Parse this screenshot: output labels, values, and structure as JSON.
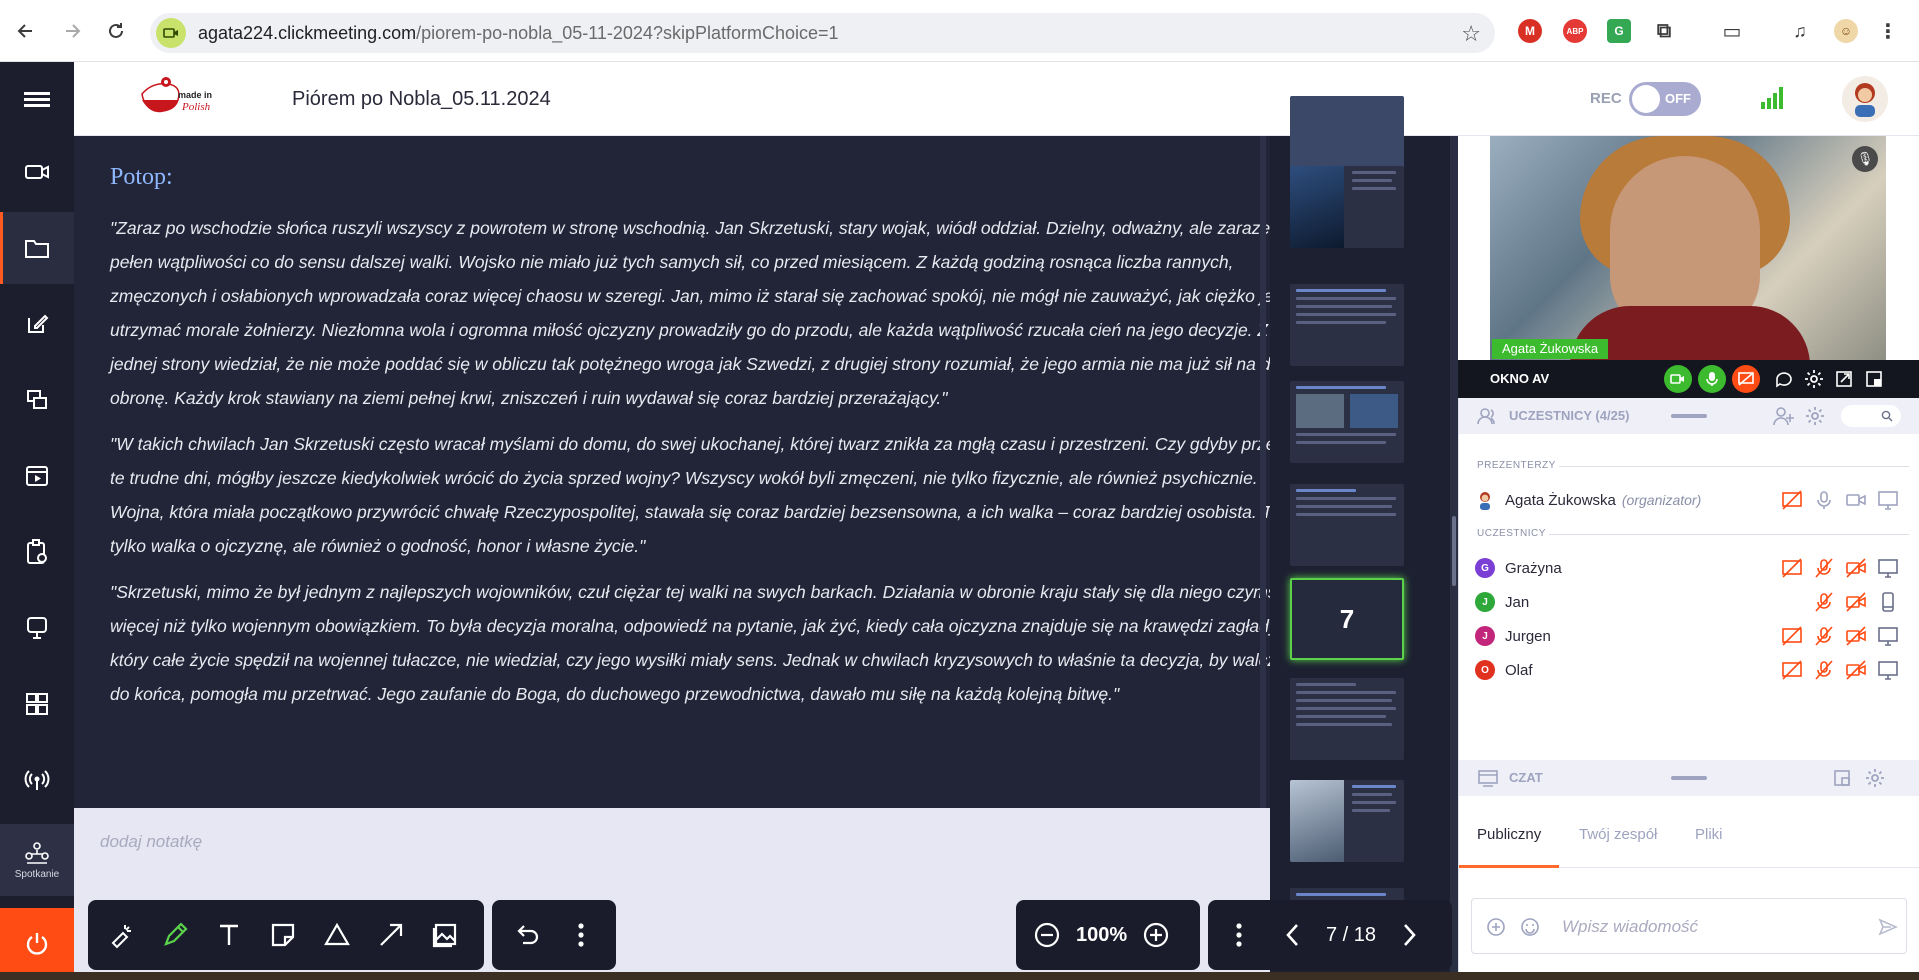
{
  "browser": {
    "url_domain": "agata224.clickmeeting.com",
    "url_path": "/piorem-po-nobla_05-11-2024?skipPlatformChoice=1"
  },
  "header": {
    "meeting_title": "Piórem po Nobla_05.11.2024",
    "rec_label": "REC",
    "rec_state": "OFF"
  },
  "sidebar": {
    "spotkanie_label": "Spotkanie"
  },
  "slide": {
    "title": "Potop:",
    "paragraphs": [
      "\"Zaraz po wschodzie słońca ruszyli wszyscy z powrotem w stronę wschodnią. Jan Skrzetuski, stary wojak, wiódł oddział. Dzielny, odważny, ale zarazem pełen wątpliwości co do sensu dalszej walki. Wojsko nie miało już tych samych sił, co przed miesiącem. Z każdą godziną rosnąca liczba rannych, zmęczonych i osłabionych wprowadzała coraz więcej chaosu w szeregi. Jan, mimo iż starał się zachować spokój, nie mógł nie zauważyć, jak ciężko jest utrzymać morale żołnierzy. Niezłomna wola i ogromna miłość ojczyzny prowadziły go do przodu, ale każda wątpliwość rzucała cień na jego decyzje. Z jednej strony wiedział, że nie może poddać się w obliczu tak potężnego wroga jak Szwedzi, z drugiej strony rozumiał, że jego armia nie ma już sił na dalszą obronę. Każdy krok stawiany na ziemi pełnej krwi, zniszczeń i ruin wydawał się coraz bardziej przerażający.\"",
      "\"W takich chwilach Jan Skrzetuski często wracał myślami do domu, do swej ukochanej, której twarz znikła za mgłą czasu i przestrzeni. Czy gdyby przeżył te trudne dni, mógłby jeszcze kiedykolwiek wrócić do życia sprzed wojny? Wszyscy wokół byli zmęczeni, nie tylko fizycznie, ale również psychicznie. Wojna, która miała początkowo przywrócić chwałę Rzeczypospolitej, stawała się coraz bardziej bezsensowna, a ich walka – coraz bardziej osobista. To nie tylko walka o ojczyznę, ale również o godność, honor i własne życie.\"",
      "\"Skrzetuski, mimo że był jednym z najlepszych wojowników, czuł ciężar tej walki na swych barkach. Działania w obronie kraju stały się dla niego czymś więcej niż tylko wojennym obowiązkiem. To była decyzja moralna, odpowiedź na pytanie, jak żyć, kiedy cała ojczyzna znajduje się na krawędzi zagłady. On, który całe życie spędził na wojennej tułaczce, nie wiedział, czy jego wysiłki miały sens. Jednak w chwilach kryzysowych to właśnie ta decyzja, by walczyć do końca, pomogła mu przetrwać. Jego zaufanie do Boga, do duchowego przewodnictwa, dawało mu siłę na każdą kolejną bitwę.\""
    ]
  },
  "notes": {
    "placeholder": "dodaj notatkę"
  },
  "thumbnails": {
    "active_number": "7"
  },
  "toolbar": {
    "zoom": "100%",
    "page_indicator": "7 / 18"
  },
  "video": {
    "presenter_name": "Agata Żukowska"
  },
  "av_panel": {
    "title": "OKNO AV"
  },
  "participants": {
    "header": "UCZESTNICY (4/25)",
    "presenters_label": "PREZENTERZY",
    "attendees_label": "UCZESTNICY",
    "presenter": {
      "name": "Agata Żukowska",
      "role": "(organizator)"
    },
    "attendees": [
      {
        "initial": "G",
        "name": "Grażyna",
        "color": "#7b3fd6"
      },
      {
        "initial": "J",
        "name": "Jan",
        "color": "#2fa83a"
      },
      {
        "initial": "J",
        "name": "Jurgen",
        "color": "#c2267a"
      },
      {
        "initial": "O",
        "name": "Olaf",
        "color": "#e0321f"
      }
    ]
  },
  "chat": {
    "header": "CZAT",
    "tabs": [
      "Publiczny",
      "Twój zespół",
      "Pliki"
    ],
    "input_placeholder": "Wpisz wiadomość"
  },
  "colors": {
    "accent_orange": "#ff4b14",
    "active_green": "#5ad24a",
    "sidebar_dark": "#1c1e2e",
    "slide_bg": "#222538",
    "slide_title": "#8fb7ff"
  }
}
